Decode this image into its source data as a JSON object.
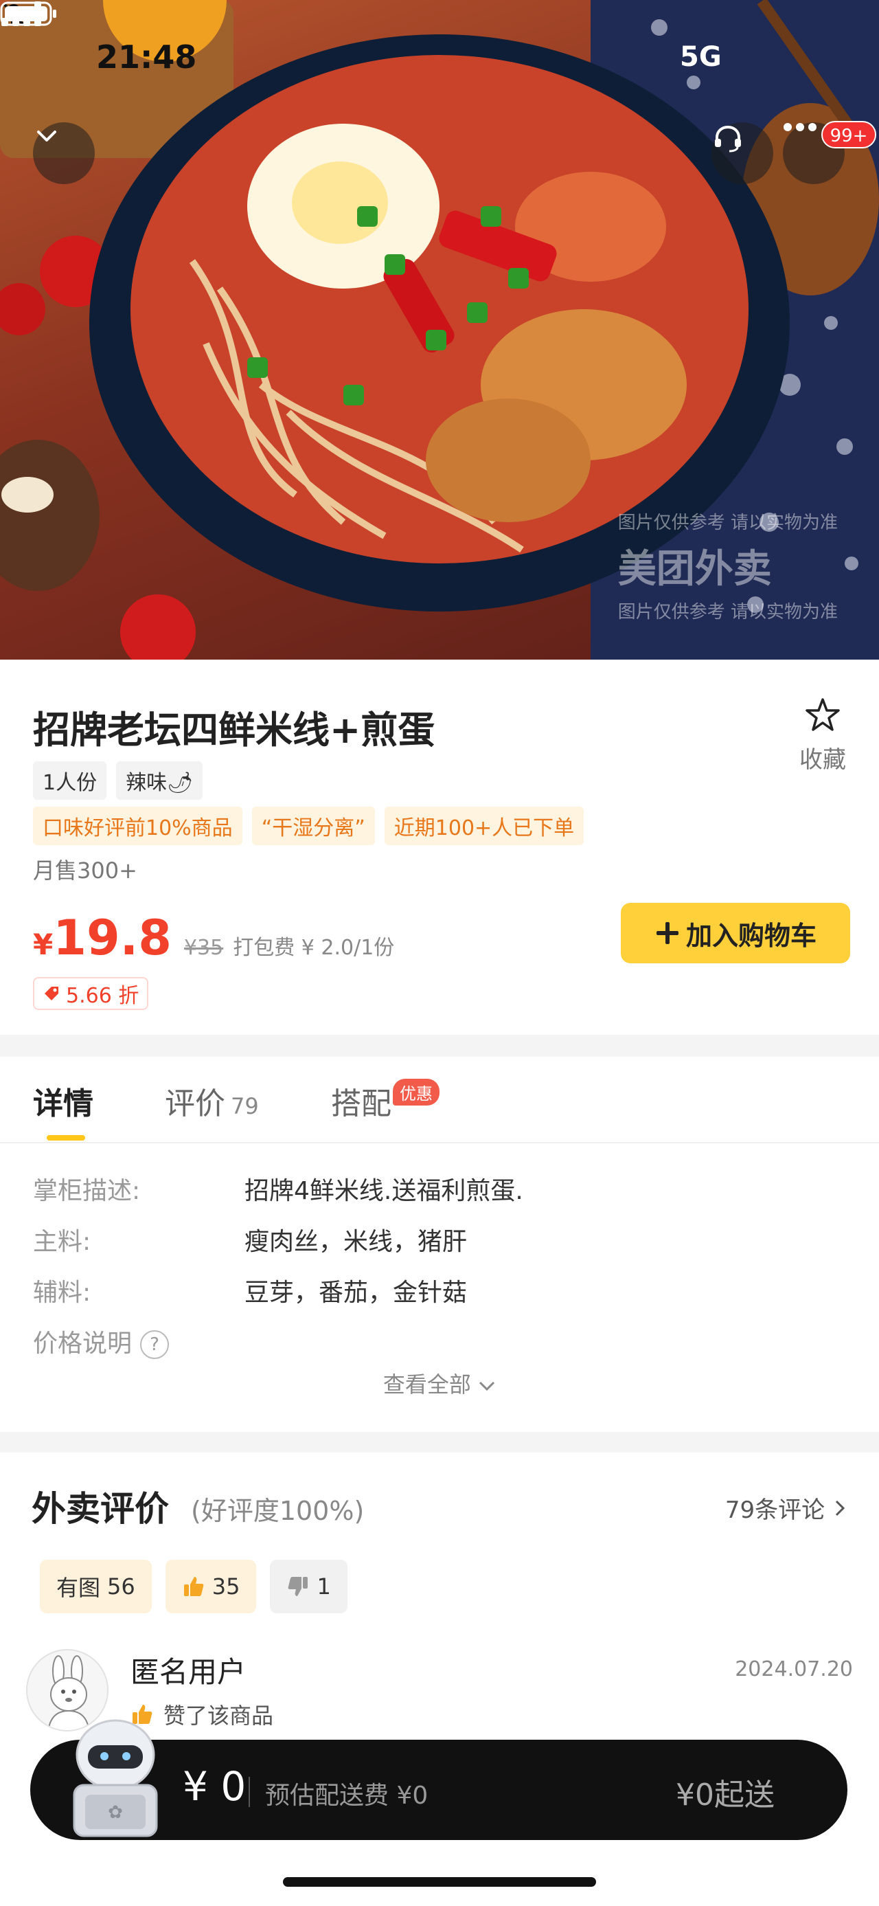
{
  "status_bar": {
    "time": "21:48",
    "network": "5G"
  },
  "header": {
    "notification_badge": "99+"
  },
  "hero": {
    "watermark_top": "图片仅供参考 请以实物为准",
    "watermark_logo": "美团外卖",
    "watermark_bottom": "图片仅供参考 请以实物为准"
  },
  "product": {
    "title": "招牌老坛四鲜米线+煎蛋",
    "favorite_label": "收藏",
    "tags": [
      "1人份",
      "辣味🌶"
    ],
    "promo_tags": [
      "口味好评前10%商品",
      "“干湿分离”",
      "近期100+人已下单"
    ],
    "monthly_sales": "月售300+",
    "price_symbol": "¥",
    "price": "19.8",
    "original_price": "¥35",
    "packing_fee": "打包费 ¥ 2.0/1份",
    "add_to_cart": "加入购物车",
    "discount": "5.66 折"
  },
  "tabs": {
    "detail": "详情",
    "review": "评价",
    "review_count": "79",
    "combo": "搭配",
    "combo_badge": "优惠"
  },
  "details": {
    "rows": [
      {
        "label": "掌柜描述:",
        "value": "招牌4鲜米线.送福利煎蛋."
      },
      {
        "label": "主料:",
        "value": "瘦肉丝，米线，猪肝"
      },
      {
        "label": "辅料:",
        "value": "豆芽，番茄，金针菇"
      },
      {
        "label": "价格说明",
        "value": ""
      }
    ],
    "see_all": "查看全部"
  },
  "reviews": {
    "title": "外卖评价",
    "rating": "(好评度100%)",
    "count": "79条评论",
    "filters": {
      "with_image": "有图",
      "with_image_count": "56",
      "thumbs_up_count": "35",
      "thumbs_down_count": "1"
    },
    "first_review": {
      "user": "匿名用户",
      "date": "2024.07.20",
      "text": "赞了该商品"
    }
  },
  "cart": {
    "total": "¥ 0",
    "shipping": "预估配送费 ¥0",
    "min_order": "¥0起送"
  },
  "colors": {
    "accent_yellow": "#ffd03a",
    "price_red": "#f2412b",
    "promo_orange": "#e8771a"
  }
}
